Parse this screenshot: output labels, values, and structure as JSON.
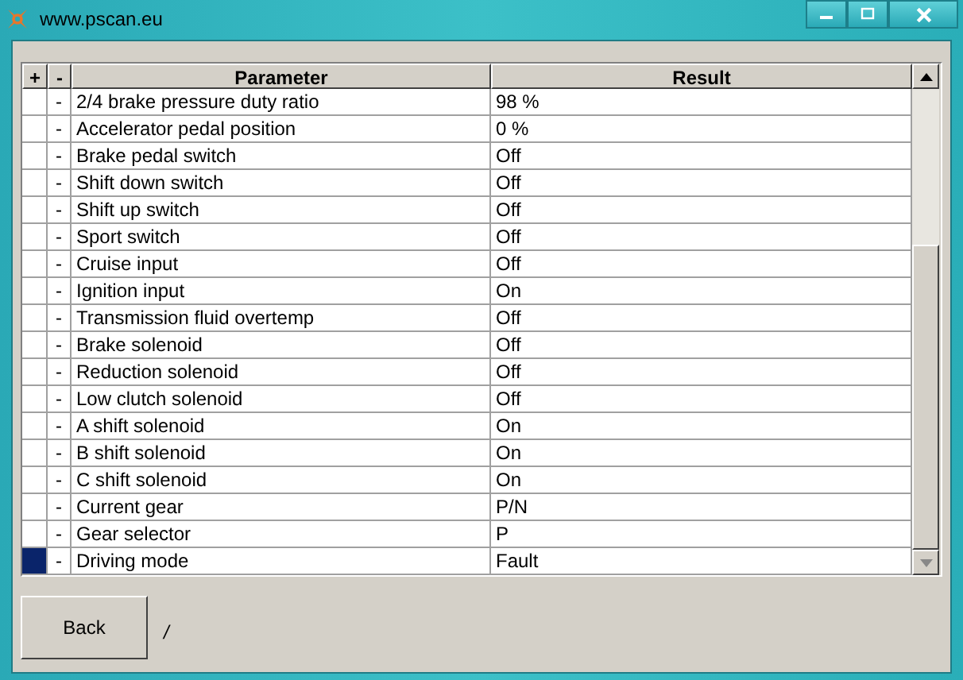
{
  "window": {
    "title": "www.pscan.eu"
  },
  "table": {
    "columns": [
      "+",
      "-",
      "Parameter",
      "Result"
    ],
    "rows": [
      {
        "mark": "-",
        "parameter": "2/4 brake pressure duty ratio",
        "result": "98 %",
        "selected": false
      },
      {
        "mark": "-",
        "parameter": "Accelerator pedal position",
        "result": "0 %",
        "selected": false
      },
      {
        "mark": "-",
        "parameter": "Brake pedal switch",
        "result": "Off",
        "selected": false
      },
      {
        "mark": "-",
        "parameter": "Shift down switch",
        "result": "Off",
        "selected": false
      },
      {
        "mark": "-",
        "parameter": "Shift up switch",
        "result": "Off",
        "selected": false
      },
      {
        "mark": "-",
        "parameter": "Sport switch",
        "result": "Off",
        "selected": false
      },
      {
        "mark": "-",
        "parameter": "Cruise input",
        "result": "Off",
        "selected": false
      },
      {
        "mark": "-",
        "parameter": "Ignition input",
        "result": "On",
        "selected": false
      },
      {
        "mark": "-",
        "parameter": "Transmission fluid overtemp",
        "result": "Off",
        "selected": false
      },
      {
        "mark": "-",
        "parameter": "Brake solenoid",
        "result": "Off",
        "selected": false
      },
      {
        "mark": "-",
        "parameter": "Reduction solenoid",
        "result": "Off",
        "selected": false
      },
      {
        "mark": "-",
        "parameter": "Low clutch solenoid",
        "result": "Off",
        "selected": false
      },
      {
        "mark": "-",
        "parameter": "A shift solenoid",
        "result": "On",
        "selected": false
      },
      {
        "mark": "-",
        "parameter": "B shift solenoid",
        "result": "On",
        "selected": false
      },
      {
        "mark": "-",
        "parameter": "C shift solenoid",
        "result": "On",
        "selected": false
      },
      {
        "mark": "-",
        "parameter": "Current gear",
        "result": "P/N",
        "selected": false
      },
      {
        "mark": "-",
        "parameter": "Gear selector",
        "result": "P",
        "selected": false
      },
      {
        "mark": "-",
        "parameter": "Driving mode",
        "result": "Fault",
        "selected": true
      }
    ]
  },
  "back_button": "Back",
  "status_text": "/"
}
